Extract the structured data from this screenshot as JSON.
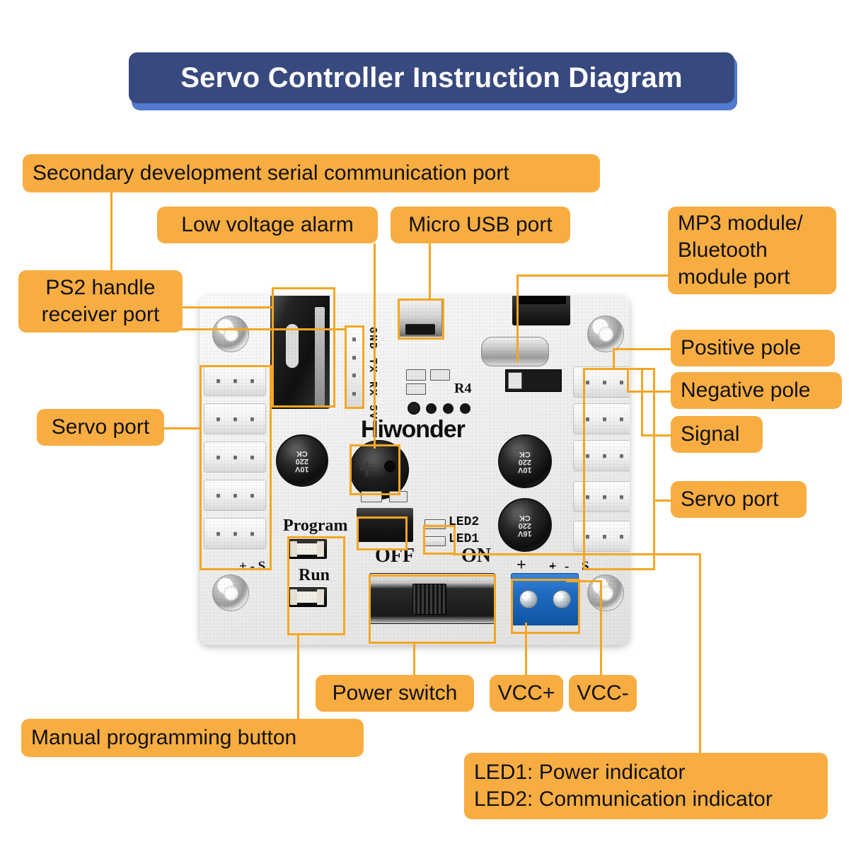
{
  "header": {
    "title": "Servo Controller Instruction Diagram",
    "bar_color": "#37497e",
    "shadow_color": "#5179ce",
    "text_color": "#ffffff"
  },
  "theme": {
    "label_bg": "#f8ad42",
    "label_text": "#111111",
    "leader_line": "#f5a623",
    "page_bg": "#ffffff"
  },
  "labels": {
    "secondary_serial": "Secondary development serial communication port",
    "low_voltage_alarm": "Low voltage alarm",
    "micro_usb": "Micro USB port",
    "mp3_bluetooth": "MP3 module/\nBluetooth\nmodule port",
    "ps2_handle": "PS2 handle\nreceiver port",
    "servo_port_left": "Servo port",
    "positive_pole": "Positive pole",
    "negative_pole": "Negative pole",
    "signal": "Signal",
    "servo_port_right": "Servo port",
    "power_switch": "Power switch",
    "vcc_plus": "VCC+",
    "vcc_minus": "VCC-",
    "manual_programming": "Manual programming button",
    "led_legend": "LED1: Power indicator\nLED2: Communication indicator"
  },
  "board": {
    "brand": "Hiwonder",
    "silkscreen": {
      "serial_pins": "GND TX RX 5V",
      "resistor_ref": "R4",
      "led2": "LED2",
      "led1": "LED1",
      "program": "Program",
      "run": "Run",
      "switch_off": "OFF",
      "switch_on": "ON",
      "terminal_plus": "+",
      "terminal_minus": "-",
      "servo_plus": "+",
      "servo_minus": "-",
      "servo_signal": "S"
    },
    "capacitors": [
      {
        "value": "220",
        "voltage": "10V",
        "series": "CK"
      },
      {
        "value": "220",
        "voltage": "16V",
        "series": "CK"
      }
    ]
  }
}
